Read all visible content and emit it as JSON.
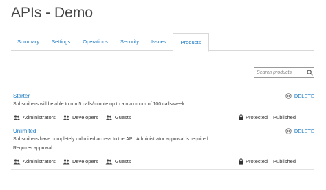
{
  "page": {
    "title": "APIs - Demo"
  },
  "tabs": [
    {
      "label": "Summary"
    },
    {
      "label": "Settings"
    },
    {
      "label": "Operations"
    },
    {
      "label": "Security"
    },
    {
      "label": "Issues"
    },
    {
      "label": "Products",
      "active": true
    }
  ],
  "search": {
    "placeholder": "Search products"
  },
  "products": [
    {
      "name": "Starter",
      "description": "Subscribers will be able to run 5 calls/minute up to a maximum of 100 calls/week.",
      "groups": [
        "Administrators",
        "Developers",
        "Guests"
      ],
      "protected_label": "Protected",
      "status": "Published",
      "delete_label": "DELETE"
    },
    {
      "name": "Unlimited",
      "description": "Subscribers have completely unlimited access to the API. Administrator approval is required.",
      "approval": "Requires approval",
      "groups": [
        "Administrators",
        "Developers",
        "Guests"
      ],
      "protected_label": "Protected",
      "status": "Published",
      "delete_label": "DELETE"
    }
  ],
  "colors": {
    "link": "#1a78c2",
    "text": "#333333"
  }
}
